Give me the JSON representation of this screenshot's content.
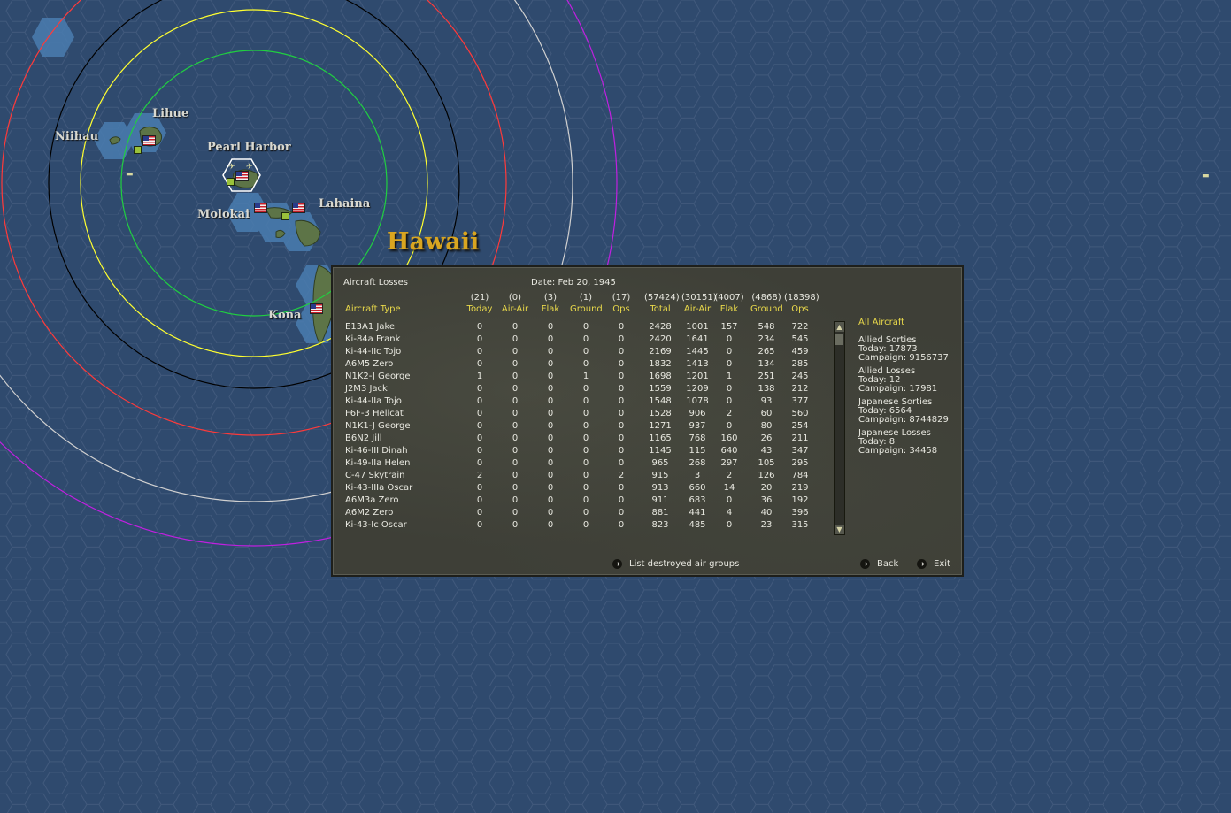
{
  "map": {
    "region_name": "Hawaii",
    "places": [
      "Lihue",
      "Niihau",
      "Pearl Harbor",
      "Molokai",
      "Lahaina",
      "Kona"
    ],
    "ring_colors": [
      "#000000",
      "#ff3a3a",
      "#ffff30",
      "#20d040",
      "#d0d0d0",
      "#c020e0"
    ]
  },
  "panel": {
    "title": "Aircraft Losses",
    "date": "Date: Feb 20, 1945",
    "col_header_type": "Aircraft Type",
    "columns": [
      {
        "count": "(21)",
        "label": "Today"
      },
      {
        "count": "(0)",
        "label": "Air-Air"
      },
      {
        "count": "(3)",
        "label": "Flak"
      },
      {
        "count": "(1)",
        "label": "Ground"
      },
      {
        "count": "(17)",
        "label": "Ops"
      },
      {
        "count": "(57424)",
        "label": "Total"
      },
      {
        "count": "(30151)",
        "label": "Air-Air"
      },
      {
        "count": "(4007)",
        "label": "Flak"
      },
      {
        "count": "(4868)",
        "label": "Ground"
      },
      {
        "count": "(18398)",
        "label": "Ops"
      }
    ],
    "rows": [
      {
        "name": "E13A1 Jake",
        "v": [
          "0",
          "0",
          "0",
          "0",
          "0",
          "2428",
          "1001",
          "157",
          "548",
          "722"
        ]
      },
      {
        "name": "Ki-84a Frank",
        "v": [
          "0",
          "0",
          "0",
          "0",
          "0",
          "2420",
          "1641",
          "0",
          "234",
          "545"
        ]
      },
      {
        "name": "Ki-44-IIc Tojo",
        "v": [
          "0",
          "0",
          "0",
          "0",
          "0",
          "2169",
          "1445",
          "0",
          "265",
          "459"
        ]
      },
      {
        "name": "A6M5 Zero",
        "v": [
          "0",
          "0",
          "0",
          "0",
          "0",
          "1832",
          "1413",
          "0",
          "134",
          "285"
        ]
      },
      {
        "name": "N1K2-J George",
        "v": [
          "1",
          "0",
          "0",
          "1",
          "0",
          "1698",
          "1201",
          "1",
          "251",
          "245"
        ]
      },
      {
        "name": "J2M3 Jack",
        "v": [
          "0",
          "0",
          "0",
          "0",
          "0",
          "1559",
          "1209",
          "0",
          "138",
          "212"
        ]
      },
      {
        "name": "Ki-44-IIa Tojo",
        "v": [
          "0",
          "0",
          "0",
          "0",
          "0",
          "1548",
          "1078",
          "0",
          "93",
          "377"
        ]
      },
      {
        "name": "F6F-3 Hellcat",
        "v": [
          "0",
          "0",
          "0",
          "0",
          "0",
          "1528",
          "906",
          "2",
          "60",
          "560"
        ]
      },
      {
        "name": "N1K1-J George",
        "v": [
          "0",
          "0",
          "0",
          "0",
          "0",
          "1271",
          "937",
          "0",
          "80",
          "254"
        ]
      },
      {
        "name": "B6N2 Jill",
        "v": [
          "0",
          "0",
          "0",
          "0",
          "0",
          "1165",
          "768",
          "160",
          "26",
          "211"
        ]
      },
      {
        "name": "Ki-46-III Dinah",
        "v": [
          "0",
          "0",
          "0",
          "0",
          "0",
          "1145",
          "115",
          "640",
          "43",
          "347"
        ]
      },
      {
        "name": "Ki-49-IIa Helen",
        "v": [
          "0",
          "0",
          "0",
          "0",
          "0",
          "965",
          "268",
          "297",
          "105",
          "295"
        ]
      },
      {
        "name": "C-47 Skytrain",
        "v": [
          "2",
          "0",
          "0",
          "0",
          "2",
          "915",
          "3",
          "2",
          "126",
          "784"
        ]
      },
      {
        "name": "Ki-43-IIIa Oscar",
        "v": [
          "0",
          "0",
          "0",
          "0",
          "0",
          "913",
          "660",
          "14",
          "20",
          "219"
        ]
      },
      {
        "name": "A6M3a Zero",
        "v": [
          "0",
          "0",
          "0",
          "0",
          "0",
          "911",
          "683",
          "0",
          "36",
          "192"
        ]
      },
      {
        "name": "A6M2 Zero",
        "v": [
          "0",
          "0",
          "0",
          "0",
          "0",
          "881",
          "441",
          "4",
          "40",
          "396"
        ]
      },
      {
        "name": "Ki-43-Ic Oscar",
        "v": [
          "0",
          "0",
          "0",
          "0",
          "0",
          "823",
          "485",
          "0",
          "23",
          "315"
        ]
      }
    ],
    "side": {
      "filter": "All Aircraft",
      "allied_sorties": "Allied Sorties",
      "allied_sorties_today": "Today:   17873",
      "allied_sorties_campaign": "Campaign: 9156737",
      "allied_losses": "Allied Losses",
      "allied_losses_today": "Today:   12",
      "allied_losses_campaign": "Campaign: 17981",
      "japanese_sorties": "Japanese Sorties",
      "japanese_sorties_today": "Today:   6564",
      "japanese_sorties_campaign": "Campaign: 8744829",
      "japanese_losses": "Japanese Losses",
      "japanese_losses_today": "Today:   8",
      "japanese_losses_campaign": "Campaign: 34458"
    },
    "buttons": {
      "list_destroyed": "List destroyed air groups",
      "back": "Back",
      "exit": "Exit"
    }
  }
}
